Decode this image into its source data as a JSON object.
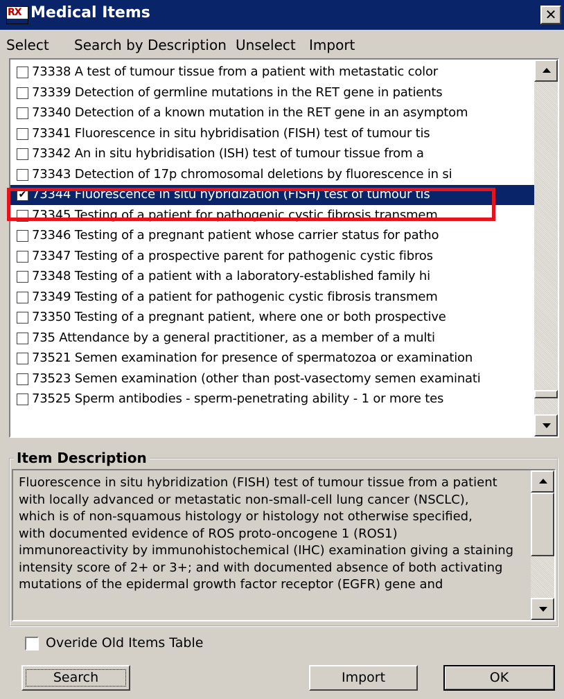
{
  "window": {
    "title": "Medical Items",
    "close_glyph": "✕",
    "app_icon": "rx-app-icon"
  },
  "menu": [
    "Select",
    "Search by Description",
    "Unselect",
    "Import"
  ],
  "list": {
    "items": [
      {
        "text": "73338 A test of tumour tissue from a patient with metastatic color",
        "checked": false,
        "selected": false
      },
      {
        "text": "73339 Detection of germline mutations in the RET gene in patients",
        "checked": false,
        "selected": false
      },
      {
        "text": "73340 Detection of a known mutation in the RET gene in an asymptom",
        "checked": false,
        "selected": false
      },
      {
        "text": "73341 Fluorescence in situ hybridisation (FISH) test of tumour tis",
        "checked": false,
        "selected": false
      },
      {
        "text": "73342 An in situ hybridisation (ISH) test of tumour tissue from a",
        "checked": false,
        "selected": false
      },
      {
        "text": "73343 Detection of 17p chromosomal deletions by fluorescence in si",
        "checked": false,
        "selected": false
      },
      {
        "text": "73344 Fluorescence in situ hybridization (FISH) test of tumour tis",
        "checked": true,
        "selected": true
      },
      {
        "text": "73345 Testing of a patient for pathogenic cystic fibrosis transmem",
        "checked": false,
        "selected": false
      },
      {
        "text": "73346 Testing of a pregnant patient whose carrier status for patho",
        "checked": false,
        "selected": false
      },
      {
        "text": "73347 Testing of a prospective parent for pathogenic cystic fibros",
        "checked": false,
        "selected": false
      },
      {
        "text": "73348 Testing of a patient with a laboratory-established family hi",
        "checked": false,
        "selected": false
      },
      {
        "text": "73349 Testing of a patient for pathogenic cystic fibrosis transmem",
        "checked": false,
        "selected": false
      },
      {
        "text": "73350 Testing of a pregnant patient, where one or both prospective",
        "checked": false,
        "selected": false
      },
      {
        "text": "735 Attendance by a general practitioner, as a member of a multi",
        "checked": false,
        "selected": false
      },
      {
        "text": "73521 Semen examination for presence of spermatozoa or examination",
        "checked": false,
        "selected": false
      },
      {
        "text": "73523 Semen examination (other than post-vasectomy semen examinati",
        "checked": false,
        "selected": false
      },
      {
        "text": "73525 Sperm antibodies - sperm-penetrating ability - 1 or more tes",
        "checked": false,
        "selected": false
      }
    ],
    "scroll_position": 0.95,
    "highlight_color": "#e3141c"
  },
  "description": {
    "title": "Item Description",
    "lines": [
      "Fluorescence in situ hybridization (FISH) test of tumour tissue from a patient",
      "with locally advanced or metastatic non-small-cell lung cancer (NSCLC),",
      "which is of non-squamous histology or histology not otherwise specified,",
      "with documented evidence of ROS proto-oncogene 1 (ROS1)",
      "immunoreactivity by immunohistochemical (IHC) examination giving a staining",
      "intensity score of 2+ or 3+; and with documented absence of both activating",
      "mutations of the epidermal growth factor receptor (EGFR) gene and"
    ],
    "scroll_position": 0.0
  },
  "override": {
    "label": "Overide Old Items Table",
    "checked": false
  },
  "buttons": {
    "search": "Search",
    "import": "Import",
    "ok": "OK"
  },
  "colors": {
    "title_bar": "#0a246a",
    "face": "#d4d0c8",
    "selection": "#0a246a"
  }
}
